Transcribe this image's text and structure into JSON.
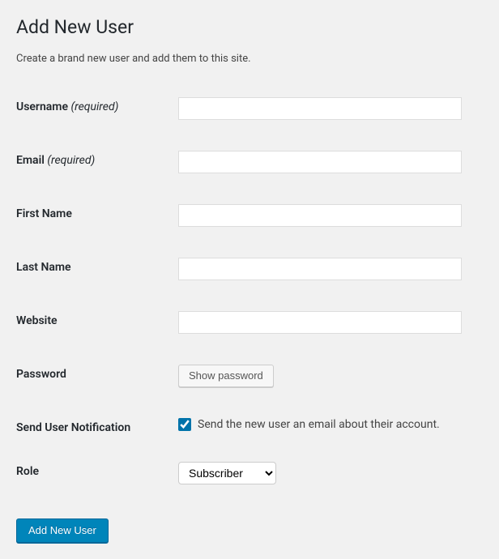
{
  "page": {
    "title": "Add New User",
    "description": "Create a brand new user and add them to this site."
  },
  "fields": {
    "username": {
      "label": "Username",
      "required_text": "(required)",
      "value": ""
    },
    "email": {
      "label": "Email",
      "required_text": "(required)",
      "value": ""
    },
    "first_name": {
      "label": "First Name",
      "value": ""
    },
    "last_name": {
      "label": "Last Name",
      "value": ""
    },
    "website": {
      "label": "Website",
      "value": ""
    },
    "password": {
      "label": "Password",
      "button_label": "Show password"
    },
    "notification": {
      "label": "Send User Notification",
      "checkbox_label": "Send the new user an email about their account.",
      "checked": true
    },
    "role": {
      "label": "Role",
      "selected": "Subscriber"
    }
  },
  "submit": {
    "label": "Add New User"
  }
}
